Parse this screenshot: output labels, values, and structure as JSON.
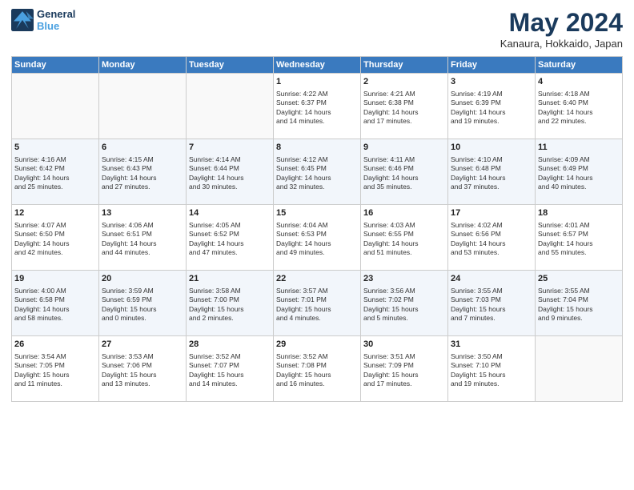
{
  "header": {
    "logo_line1": "General",
    "logo_line2": "Blue",
    "month": "May 2024",
    "location": "Kanaura, Hokkaido, Japan"
  },
  "weekdays": [
    "Sunday",
    "Monday",
    "Tuesday",
    "Wednesday",
    "Thursday",
    "Friday",
    "Saturday"
  ],
  "weeks": [
    [
      {
        "day": "",
        "info": ""
      },
      {
        "day": "",
        "info": ""
      },
      {
        "day": "",
        "info": ""
      },
      {
        "day": "1",
        "info": "Sunrise: 4:22 AM\nSunset: 6:37 PM\nDaylight: 14 hours\nand 14 minutes."
      },
      {
        "day": "2",
        "info": "Sunrise: 4:21 AM\nSunset: 6:38 PM\nDaylight: 14 hours\nand 17 minutes."
      },
      {
        "day": "3",
        "info": "Sunrise: 4:19 AM\nSunset: 6:39 PM\nDaylight: 14 hours\nand 19 minutes."
      },
      {
        "day": "4",
        "info": "Sunrise: 4:18 AM\nSunset: 6:40 PM\nDaylight: 14 hours\nand 22 minutes."
      }
    ],
    [
      {
        "day": "5",
        "info": "Sunrise: 4:16 AM\nSunset: 6:42 PM\nDaylight: 14 hours\nand 25 minutes."
      },
      {
        "day": "6",
        "info": "Sunrise: 4:15 AM\nSunset: 6:43 PM\nDaylight: 14 hours\nand 27 minutes."
      },
      {
        "day": "7",
        "info": "Sunrise: 4:14 AM\nSunset: 6:44 PM\nDaylight: 14 hours\nand 30 minutes."
      },
      {
        "day": "8",
        "info": "Sunrise: 4:12 AM\nSunset: 6:45 PM\nDaylight: 14 hours\nand 32 minutes."
      },
      {
        "day": "9",
        "info": "Sunrise: 4:11 AM\nSunset: 6:46 PM\nDaylight: 14 hours\nand 35 minutes."
      },
      {
        "day": "10",
        "info": "Sunrise: 4:10 AM\nSunset: 6:48 PM\nDaylight: 14 hours\nand 37 minutes."
      },
      {
        "day": "11",
        "info": "Sunrise: 4:09 AM\nSunset: 6:49 PM\nDaylight: 14 hours\nand 40 minutes."
      }
    ],
    [
      {
        "day": "12",
        "info": "Sunrise: 4:07 AM\nSunset: 6:50 PM\nDaylight: 14 hours\nand 42 minutes."
      },
      {
        "day": "13",
        "info": "Sunrise: 4:06 AM\nSunset: 6:51 PM\nDaylight: 14 hours\nand 44 minutes."
      },
      {
        "day": "14",
        "info": "Sunrise: 4:05 AM\nSunset: 6:52 PM\nDaylight: 14 hours\nand 47 minutes."
      },
      {
        "day": "15",
        "info": "Sunrise: 4:04 AM\nSunset: 6:53 PM\nDaylight: 14 hours\nand 49 minutes."
      },
      {
        "day": "16",
        "info": "Sunrise: 4:03 AM\nSunset: 6:55 PM\nDaylight: 14 hours\nand 51 minutes."
      },
      {
        "day": "17",
        "info": "Sunrise: 4:02 AM\nSunset: 6:56 PM\nDaylight: 14 hours\nand 53 minutes."
      },
      {
        "day": "18",
        "info": "Sunrise: 4:01 AM\nSunset: 6:57 PM\nDaylight: 14 hours\nand 55 minutes."
      }
    ],
    [
      {
        "day": "19",
        "info": "Sunrise: 4:00 AM\nSunset: 6:58 PM\nDaylight: 14 hours\nand 58 minutes."
      },
      {
        "day": "20",
        "info": "Sunrise: 3:59 AM\nSunset: 6:59 PM\nDaylight: 15 hours\nand 0 minutes."
      },
      {
        "day": "21",
        "info": "Sunrise: 3:58 AM\nSunset: 7:00 PM\nDaylight: 15 hours\nand 2 minutes."
      },
      {
        "day": "22",
        "info": "Sunrise: 3:57 AM\nSunset: 7:01 PM\nDaylight: 15 hours\nand 4 minutes."
      },
      {
        "day": "23",
        "info": "Sunrise: 3:56 AM\nSunset: 7:02 PM\nDaylight: 15 hours\nand 5 minutes."
      },
      {
        "day": "24",
        "info": "Sunrise: 3:55 AM\nSunset: 7:03 PM\nDaylight: 15 hours\nand 7 minutes."
      },
      {
        "day": "25",
        "info": "Sunrise: 3:55 AM\nSunset: 7:04 PM\nDaylight: 15 hours\nand 9 minutes."
      }
    ],
    [
      {
        "day": "26",
        "info": "Sunrise: 3:54 AM\nSunset: 7:05 PM\nDaylight: 15 hours\nand 11 minutes."
      },
      {
        "day": "27",
        "info": "Sunrise: 3:53 AM\nSunset: 7:06 PM\nDaylight: 15 hours\nand 13 minutes."
      },
      {
        "day": "28",
        "info": "Sunrise: 3:52 AM\nSunset: 7:07 PM\nDaylight: 15 hours\nand 14 minutes."
      },
      {
        "day": "29",
        "info": "Sunrise: 3:52 AM\nSunset: 7:08 PM\nDaylight: 15 hours\nand 16 minutes."
      },
      {
        "day": "30",
        "info": "Sunrise: 3:51 AM\nSunset: 7:09 PM\nDaylight: 15 hours\nand 17 minutes."
      },
      {
        "day": "31",
        "info": "Sunrise: 3:50 AM\nSunset: 7:10 PM\nDaylight: 15 hours\nand 19 minutes."
      },
      {
        "day": "",
        "info": ""
      }
    ]
  ]
}
